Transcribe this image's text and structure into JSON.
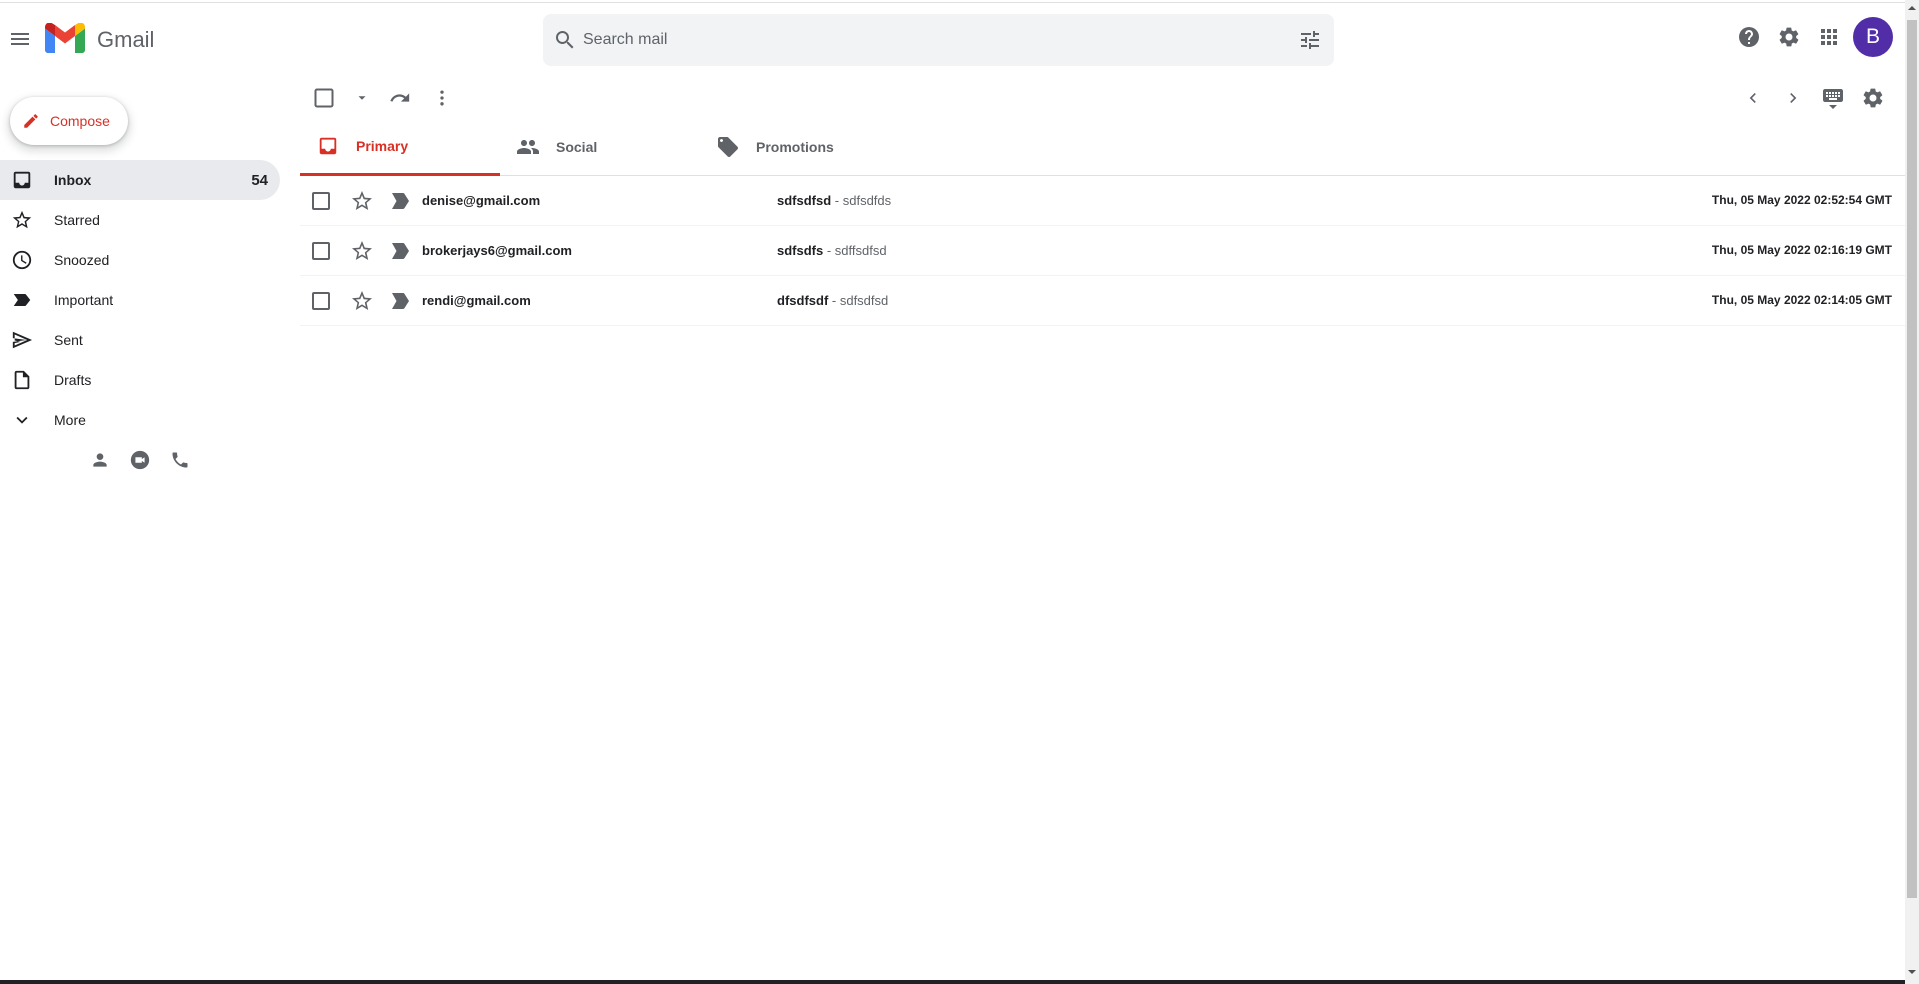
{
  "app": {
    "name": "Gmail"
  },
  "search": {
    "placeholder": "Search mail"
  },
  "account": {
    "initial": "B",
    "color": "#512da8"
  },
  "compose": {
    "label": "Compose"
  },
  "sidebar": {
    "items": [
      {
        "label": "Inbox",
        "count": "54",
        "icon": "inbox-icon",
        "active": true
      },
      {
        "label": "Starred",
        "count": "",
        "icon": "star-icon"
      },
      {
        "label": "Snoozed",
        "count": "",
        "icon": "clock-icon"
      },
      {
        "label": "Important",
        "count": "",
        "icon": "label-important-icon"
      },
      {
        "label": "Sent",
        "count": "",
        "icon": "send-icon"
      },
      {
        "label": "Drafts",
        "count": "",
        "icon": "draft-icon"
      },
      {
        "label": "More",
        "count": "",
        "icon": "chevron-down-icon"
      }
    ]
  },
  "tabs": [
    {
      "label": "Primary",
      "icon": "inbox-icon",
      "active": true
    },
    {
      "label": "Social",
      "icon": "people-icon"
    },
    {
      "label": "Promotions",
      "icon": "tag-icon"
    }
  ],
  "emails": [
    {
      "sender": "denise@gmail.com",
      "subject": "sdfsdfsd",
      "separator": " - ",
      "snippet": "sdfsdfds",
      "date": "Thu, 05 May 2022 02:52:54 GMT"
    },
    {
      "sender": "brokerjays6@gmail.com",
      "subject": "sdfsdfs",
      "separator": " - ",
      "snippet": "sdffsdfsd",
      "date": "Thu, 05 May 2022 02:16:19 GMT"
    },
    {
      "sender": "rendi@gmail.com",
      "subject": "dfsdfsdf",
      "separator": " - ",
      "snippet": "sdfsdfsd",
      "date": "Thu, 05 May 2022 02:14:05 GMT"
    }
  ],
  "colors": {
    "accent": "#d93025",
    "text": "#202124",
    "muted": "#5f6368",
    "active_bg": "#e8eaed"
  }
}
